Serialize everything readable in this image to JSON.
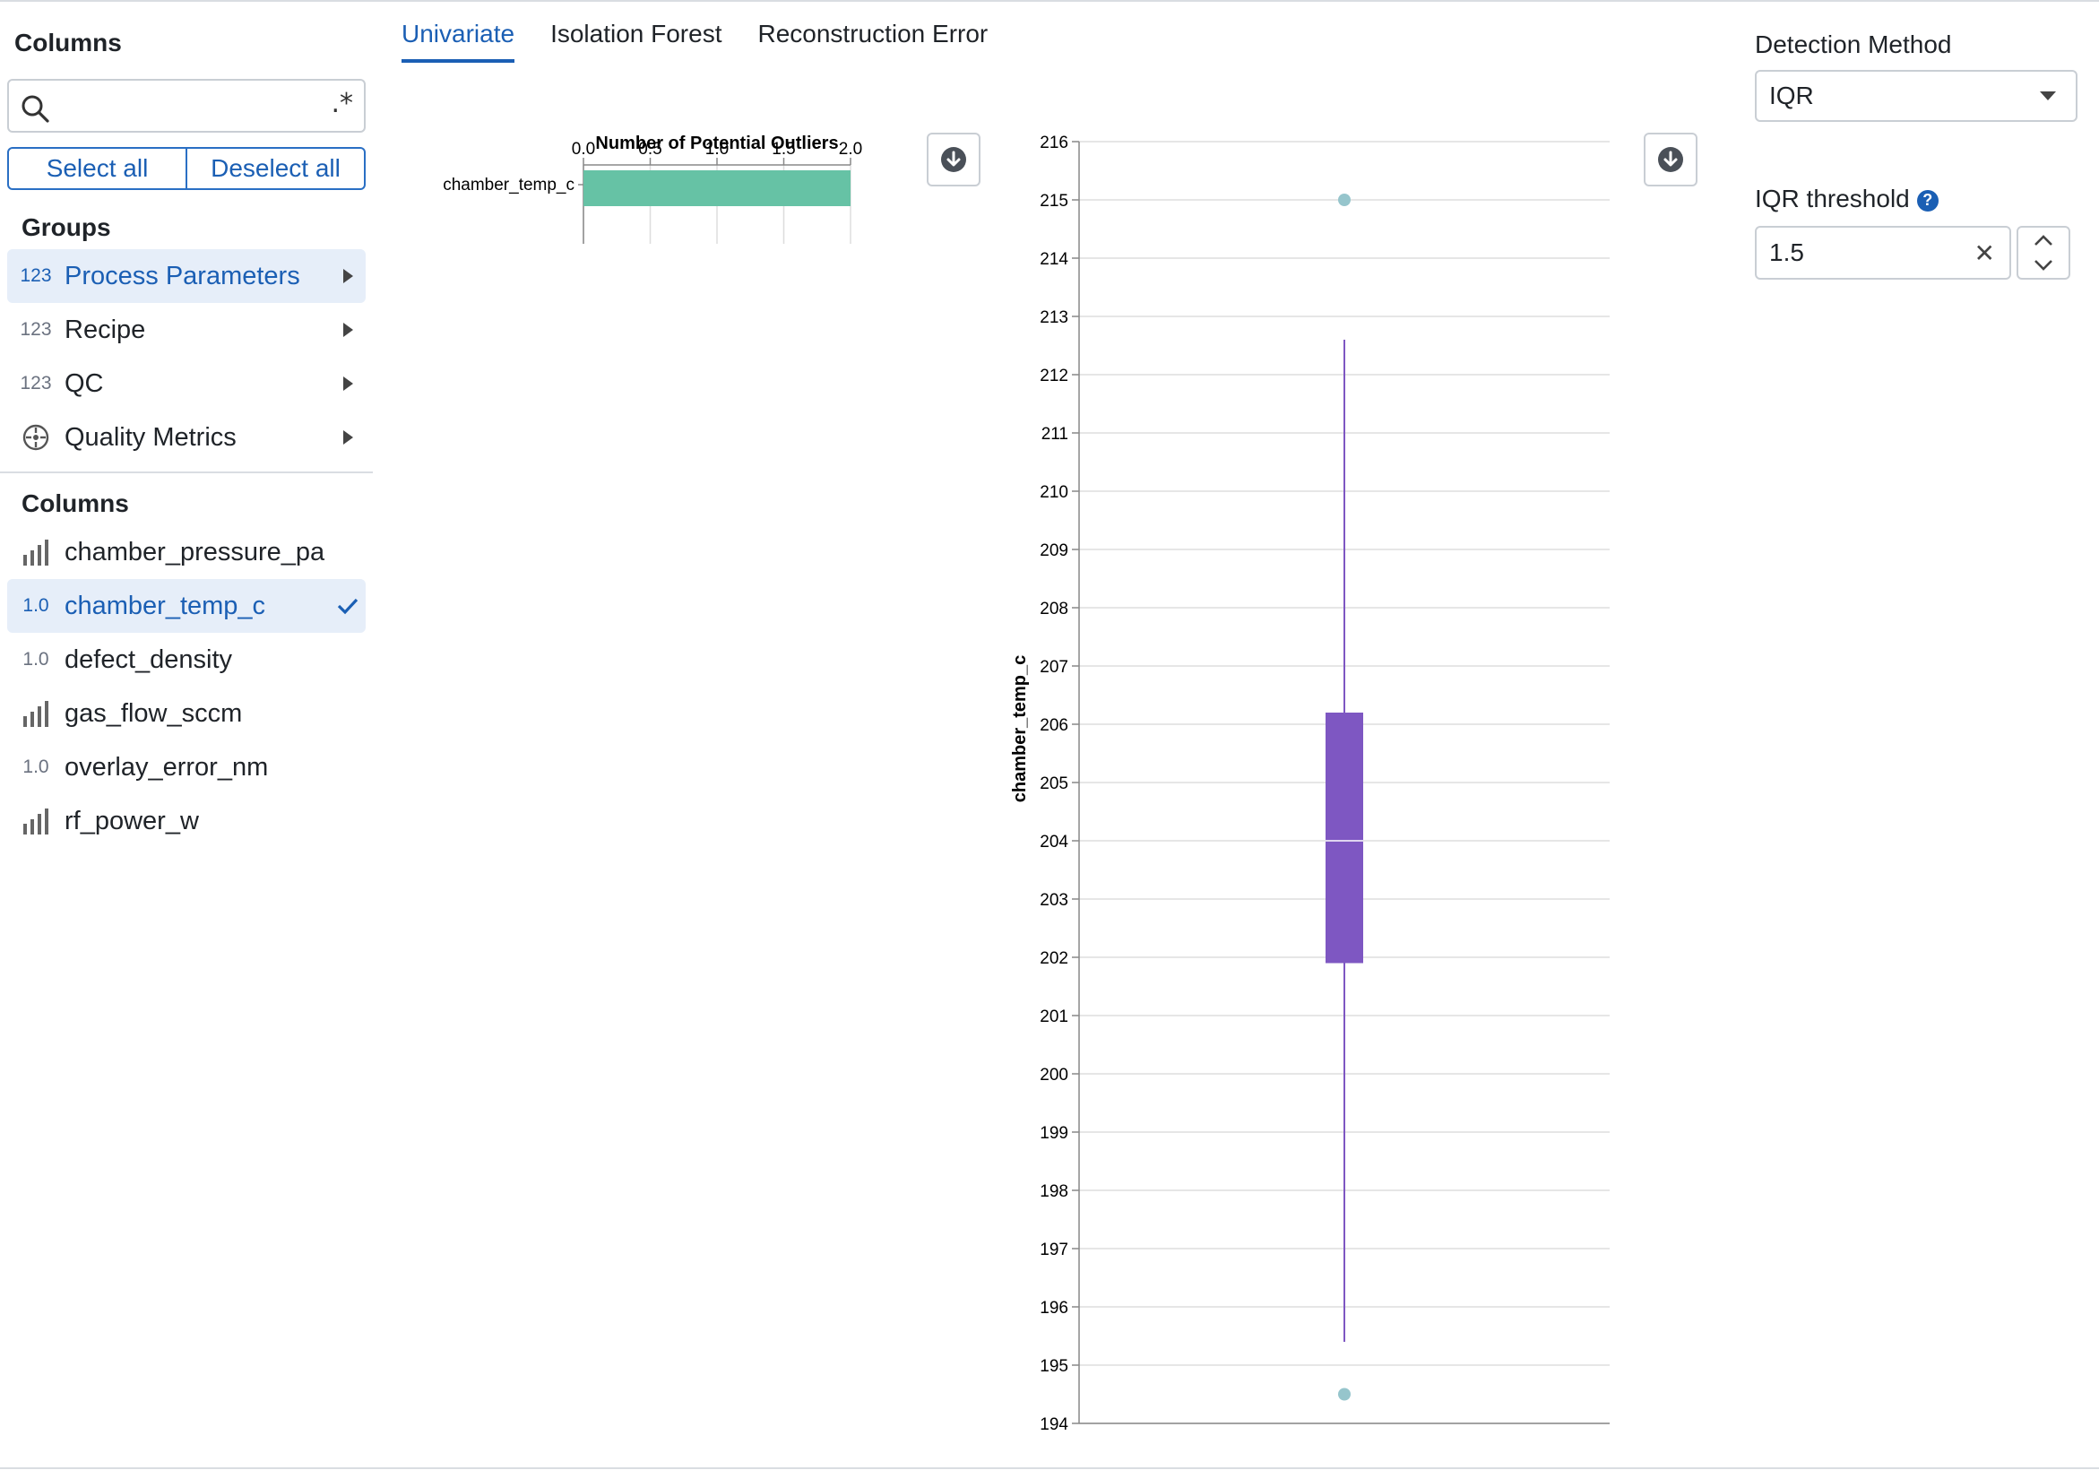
{
  "sidebar": {
    "title": "Columns",
    "search": {
      "placeholder": "",
      "regex_label": ".*"
    },
    "select_all": "Select all",
    "deselect_all": "Deselect all",
    "groups_title": "Groups",
    "groups": [
      {
        "type": "123",
        "label": "Process Parameters",
        "active": true
      },
      {
        "type": "123",
        "label": "Recipe",
        "active": false
      },
      {
        "type": "123",
        "label": "QC",
        "active": false
      },
      {
        "type": "target-icon",
        "label": "Quality Metrics",
        "active": false
      }
    ],
    "columns_title": "Columns",
    "columns": [
      {
        "type": "bars-icon",
        "label": "chamber_pressure_pa",
        "selected": false
      },
      {
        "type": "1.0",
        "label": "chamber_temp_c",
        "selected": true
      },
      {
        "type": "1.0",
        "label": "defect_density",
        "selected": false
      },
      {
        "type": "bars-icon",
        "label": "gas_flow_sccm",
        "selected": false
      },
      {
        "type": "1.0",
        "label": "overlay_error_nm",
        "selected": false
      },
      {
        "type": "bars-icon",
        "label": "rf_power_w",
        "selected": false
      }
    ]
  },
  "tabs": [
    {
      "label": "Univariate",
      "active": true
    },
    {
      "label": "Isolation Forest",
      "active": false
    },
    {
      "label": "Reconstruction Error",
      "active": false
    }
  ],
  "controls": {
    "method_label": "Detection Method",
    "method_value": "IQR",
    "threshold_label": "IQR threshold",
    "threshold_help": "?",
    "threshold_value": "1.5",
    "clear_symbol": "✕"
  },
  "colors": {
    "accent": "#1b5fb4",
    "bar": "#66c2a5",
    "box": "#7e57c2",
    "outlier": "#96c5cc"
  },
  "chart_data": [
    {
      "type": "bar",
      "title": "Number of Potential Outliers",
      "categories": [
        "chamber_temp_c"
      ],
      "values": [
        2
      ],
      "xlim": [
        0,
        2
      ],
      "xticks": [
        0.0,
        0.5,
        1.0,
        1.5,
        2.0
      ],
      "xtick_labels": [
        "0.0",
        "0.5",
        "1.0",
        "1.5",
        "2.0"
      ],
      "grid": true
    },
    {
      "type": "box",
      "ylabel": "chamber_temp_c",
      "ylim": [
        194,
        216
      ],
      "yticks": [
        194,
        195,
        196,
        197,
        198,
        199,
        200,
        201,
        202,
        203,
        204,
        205,
        206,
        207,
        208,
        209,
        210,
        211,
        212,
        213,
        214,
        215,
        216
      ],
      "whisker_low": 195.4,
      "q1": 201.9,
      "median": 204.0,
      "q3": 206.2,
      "whisker_high": 212.6,
      "outliers": [
        215.0,
        194.5
      ],
      "grid": true
    }
  ]
}
